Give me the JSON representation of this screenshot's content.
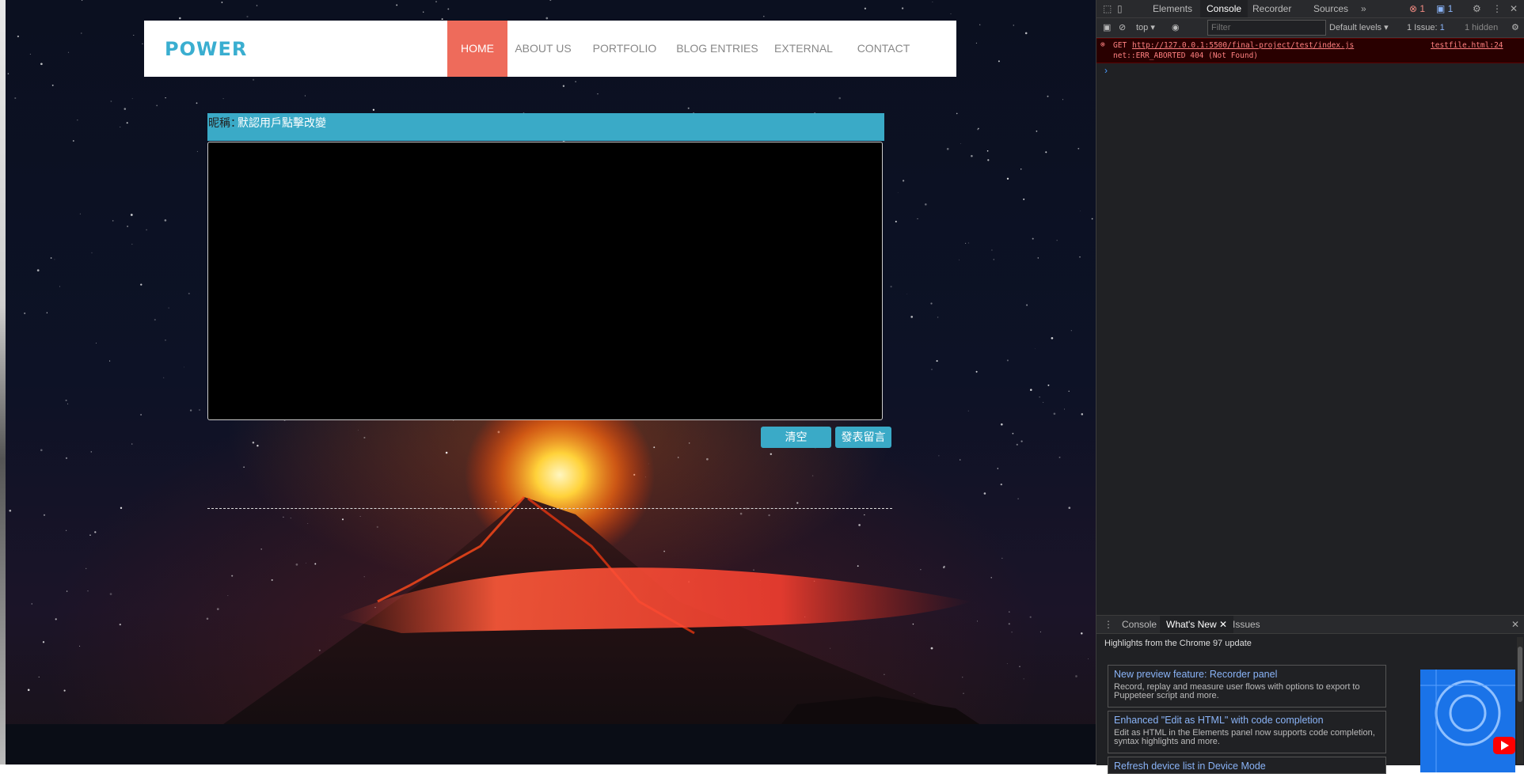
{
  "nav": {
    "logo": "POWER",
    "items": [
      {
        "label": "HOME",
        "active": true
      },
      {
        "label": "ABOUT US"
      },
      {
        "label": "PORTFOLIO"
      },
      {
        "label": "BLOG ENTRIES"
      },
      {
        "label": "EXTERNAL"
      },
      {
        "label": "CONTACT"
      }
    ]
  },
  "comment": {
    "name_label": "昵稱：",
    "name_value": "默認用戶點擊改變",
    "clear_button": "清空",
    "submit_button": "發表留言"
  },
  "devtools": {
    "tabs": [
      "Elements",
      "Console",
      "Recorder",
      "Sources"
    ],
    "active_tab": "Console",
    "error_badge": "1",
    "message_badge": "1",
    "context": "top",
    "filter_placeholder": "Filter",
    "levels": "Default levels",
    "issues": "1 Issue:",
    "issues_count": "1",
    "hidden": "1 hidden",
    "error": {
      "method": "GET",
      "url": "http://127.0.0.1:5500/final-project/test/index.js",
      "source": "testfile.html:24",
      "message": "net::ERR_ABORTED 404 (Not Found)"
    },
    "drawer": {
      "tabs": [
        "Console",
        "What's New",
        "Issues"
      ],
      "active_tab": "What's New",
      "heading": "Highlights from the Chrome 97 update",
      "cards": [
        {
          "title": "New preview feature: Recorder panel",
          "desc": "Record, replay and measure user flows with options to export to Puppeteer script and more."
        },
        {
          "title": "Enhanced \"Edit as HTML\" with code completion",
          "desc": "Edit as HTML in the Elements panel now supports code completion, syntax highlights and more."
        },
        {
          "title": "Refresh device list in Device Mode",
          "desc": ""
        }
      ]
    },
    "colors": {
      "error": "#ff8080",
      "link": "#8ab4f8",
      "accent": "#1a73e8"
    }
  },
  "colors": {
    "nav_active": "#ee6b5b",
    "accent": "#3aaac7",
    "logo": "#3aaed0"
  }
}
